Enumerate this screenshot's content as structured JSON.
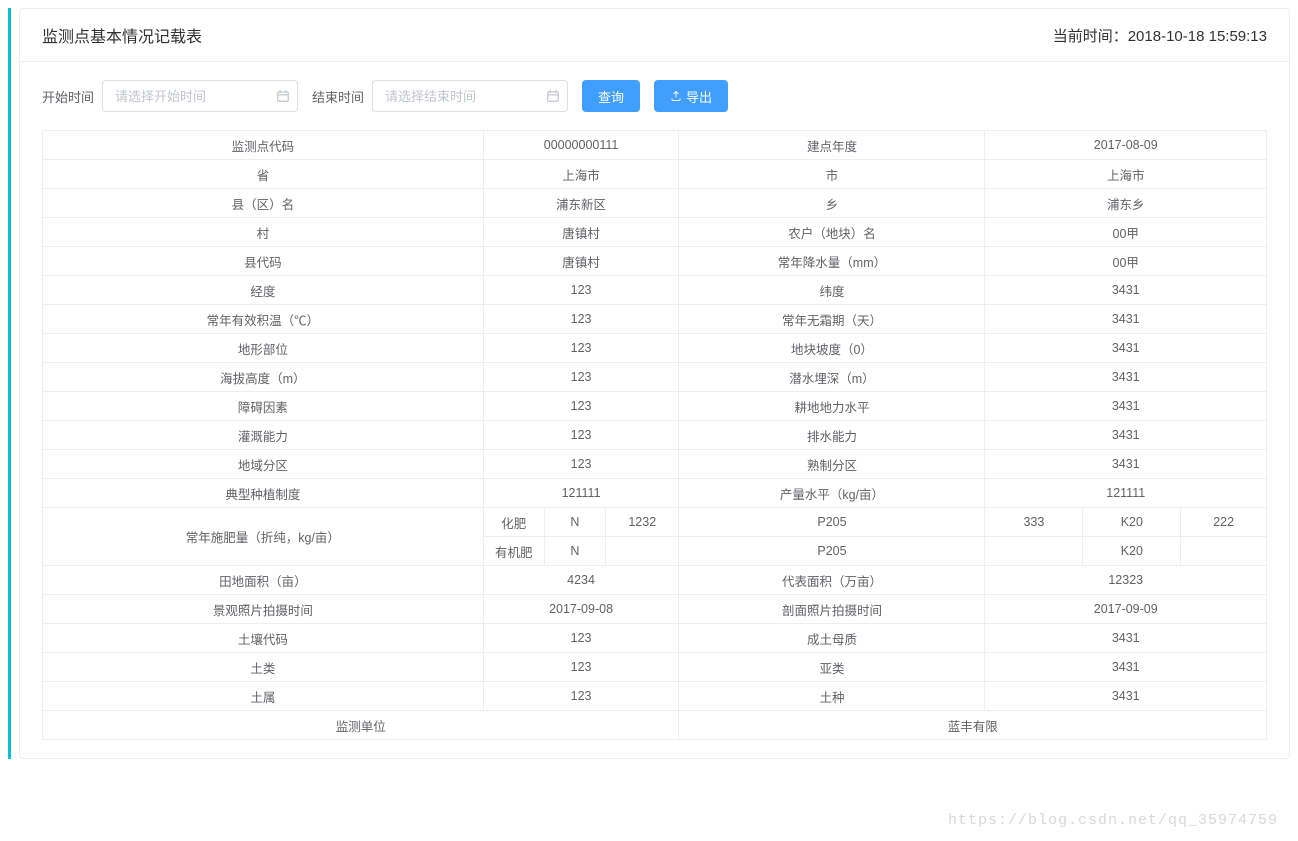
{
  "header": {
    "title": "监测点基本情况记载表",
    "current_time_label": "当前时间：",
    "current_time_value": "2018-10-18 15:59:13"
  },
  "filters": {
    "start_label": "开始时间",
    "start_placeholder": "请选择开始时间",
    "end_label": "结束时间",
    "end_placeholder": "请选择结束时间",
    "query_label": "查询",
    "export_label": "导出"
  },
  "rows": [
    {
      "k1": "监测点代码",
      "v1": "00000000111",
      "k2": "建点年度",
      "v2": "2017-08-09"
    },
    {
      "k1": "省",
      "v1": "上海市",
      "k2": "市",
      "v2": "上海市"
    },
    {
      "k1": "县（区）名",
      "v1": "浦东新区",
      "k2": "乡",
      "v2": "浦东乡"
    },
    {
      "k1": "村",
      "v1": "唐镇村",
      "k2": "农户（地块）名",
      "v2": "00甲"
    },
    {
      "k1": "县代码",
      "v1": "唐镇村",
      "k2": "常年降水量（mm）",
      "v2": "00甲"
    },
    {
      "k1": "经度",
      "v1": "123",
      "k2": "纬度",
      "v2": "3431"
    },
    {
      "k1": "常年有效积温（℃）",
      "v1": "123",
      "k2": "常年无霜期（天）",
      "v2": "3431"
    },
    {
      "k1": "地形部位",
      "v1": "123",
      "k2": "地块坡度（0）",
      "v2": "3431"
    },
    {
      "k1": "海拔高度（m）",
      "v1": "123",
      "k2": "潜水埋深（m）",
      "v2": "3431"
    },
    {
      "k1": "障碍因素",
      "v1": "123",
      "k2": "耕地地力水平",
      "v2": "3431"
    },
    {
      "k1": "灌溉能力",
      "v1": "123",
      "k2": "排水能力",
      "v2": "3431"
    },
    {
      "k1": "地域分区",
      "v1": "123",
      "k2": "熟制分区",
      "v2": "3431"
    },
    {
      "k1": "典型种植制度",
      "v1": "121111",
      "k2": "产量水平（kg/亩）",
      "v2": "121111"
    }
  ],
  "fertilizer": {
    "row_label": "常年施肥量（折纯，kg/亩）",
    "chem_label": "化肥",
    "org_label": "有机肥",
    "n_label": "N",
    "p_label": "P205",
    "k_label": "K20",
    "chem_n": "1232",
    "chem_p": "333",
    "chem_k": "222",
    "org_n": "",
    "org_p": "",
    "org_k": ""
  },
  "rows2": [
    {
      "k1": "田地面积（亩）",
      "v1": "4234",
      "k2": "代表面积（万亩）",
      "v2": "12323"
    },
    {
      "k1": "景观照片拍摄时间",
      "v1": "2017-09-08",
      "k2": "剖面照片拍摄时间",
      "v2": "2017-09-09"
    },
    {
      "k1": "土壤代码",
      "v1": "123",
      "k2": "成土母质",
      "v2": "3431"
    },
    {
      "k1": "土类",
      "v1": "123",
      "k2": "亚类",
      "v2": "3431"
    },
    {
      "k1": "土属",
      "v1": "123",
      "k2": "土种",
      "v2": "3431"
    }
  ],
  "footer": {
    "k": "监测单位",
    "v": "蓝丰有限"
  },
  "watermark": "https://blog.csdn.net/qq_35974759"
}
